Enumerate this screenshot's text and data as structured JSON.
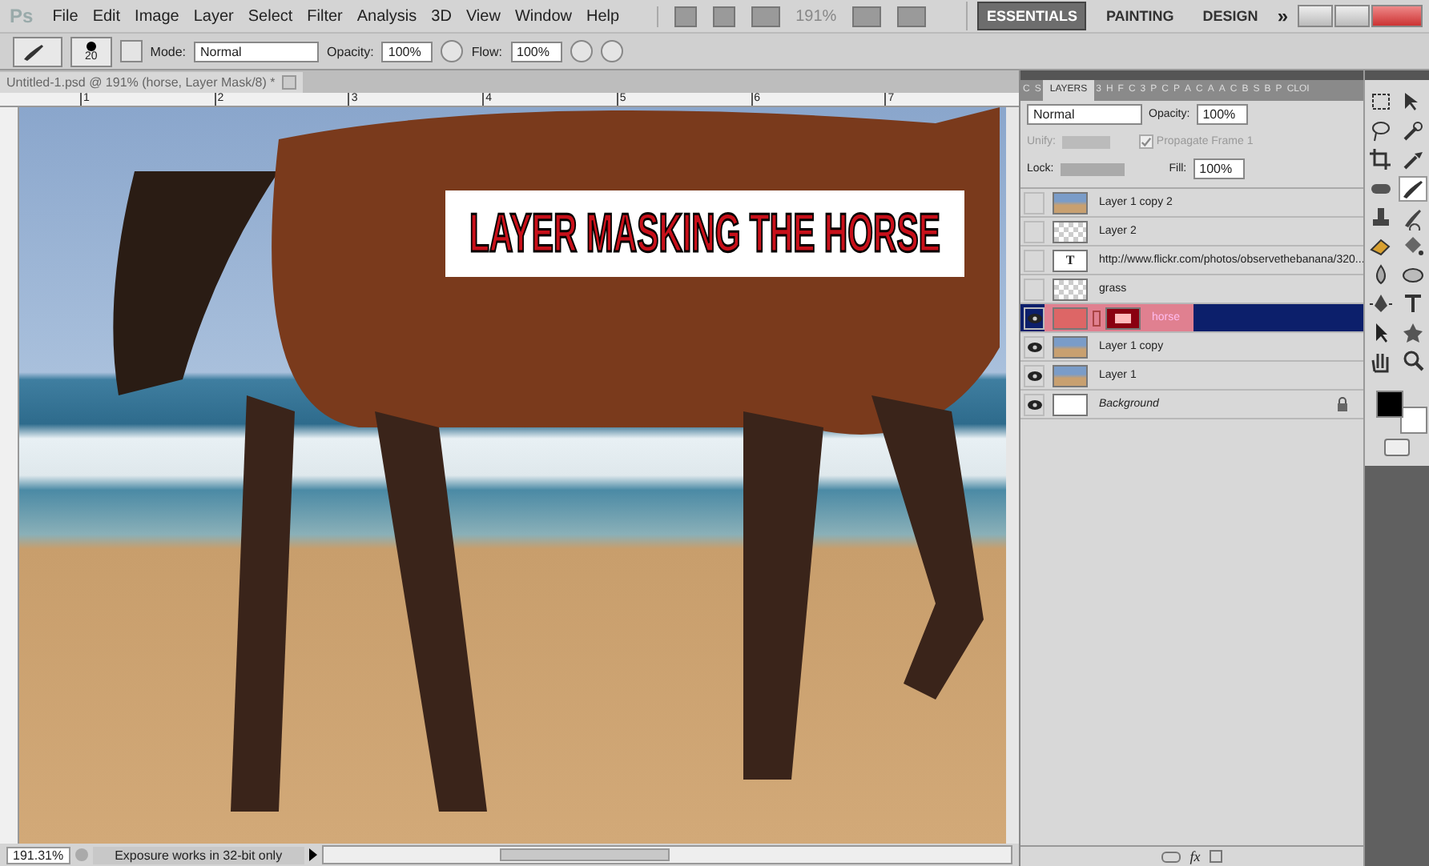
{
  "app_logo": "Ps",
  "menu": [
    "File",
    "Edit",
    "Image",
    "Layer",
    "Select",
    "Filter",
    "Analysis",
    "3D",
    "View",
    "Window",
    "Help"
  ],
  "zoom_menu": "191%",
  "workspaces": [
    {
      "label": "ESSENTIALS",
      "selected": true
    },
    {
      "label": "PAINTING",
      "selected": false
    },
    {
      "label": "DESIGN",
      "selected": false
    }
  ],
  "more_workspaces": "»",
  "options_bar": {
    "brush_size": "20",
    "mode_label": "Mode:",
    "mode": "Normal",
    "opacity_label": "Opacity:",
    "opacity": "100%",
    "flow_label": "Flow:",
    "flow": "100%"
  },
  "document_tab": {
    "title": "Untitled-1.psd @ 191% (horse, Layer Mask/8) *"
  },
  "ruler": [
    "1",
    "2",
    "3",
    "4",
    "5",
    "6",
    "7"
  ],
  "canvas_text": "LAYER MASKING THE HORSE",
  "layers_panel": {
    "tabs": [
      {
        "label": "C",
        "selected": false
      },
      {
        "label": "S",
        "selected": false
      },
      {
        "label": "LAYERS",
        "selected": true
      },
      {
        "label": "3",
        "selected": false
      },
      {
        "label": "H",
        "selected": false
      },
      {
        "label": "F",
        "selected": false
      },
      {
        "label": "C",
        "selected": false
      },
      {
        "label": "3",
        "selected": false
      },
      {
        "label": "P",
        "selected": false
      },
      {
        "label": "C",
        "selected": false
      },
      {
        "label": "P",
        "selected": false
      },
      {
        "label": "A",
        "selected": false
      },
      {
        "label": "C",
        "selected": false
      },
      {
        "label": "A",
        "selected": false
      },
      {
        "label": "A",
        "selected": false
      },
      {
        "label": "C",
        "selected": false
      },
      {
        "label": "B",
        "selected": false
      },
      {
        "label": "S",
        "selected": false
      },
      {
        "label": "B",
        "selected": false
      },
      {
        "label": "P",
        "selected": false
      },
      {
        "label": "CLOI",
        "selected": false
      }
    ],
    "blend_mode": "Normal",
    "opacity_label": "Opacity:",
    "opacity": "100%",
    "unify_label": "Unify:",
    "propagate": {
      "label": "Propagate Frame 1",
      "checked": true,
      "disabled": true
    },
    "lock_label": "Lock:",
    "fill_label": "Fill:",
    "fill": "100%",
    "layers": [
      {
        "name": "Layer 1 copy 2",
        "visible": false,
        "selected": false,
        "kind": "photo",
        "locked": false
      },
      {
        "name": "Layer 2",
        "visible": false,
        "selected": false,
        "kind": "transparent",
        "locked": false
      },
      {
        "name": "http://www.flickr.com/photos/observethebanana/320...",
        "visible": false,
        "selected": false,
        "kind": "text",
        "thumb_text": "T",
        "locked": false
      },
      {
        "name": "grass",
        "visible": false,
        "selected": false,
        "kind": "transparent",
        "locked": false
      },
      {
        "name": "horse",
        "visible": true,
        "selected": true,
        "kind": "masked",
        "locked": false
      },
      {
        "name": "Layer 1 copy",
        "visible": true,
        "selected": false,
        "kind": "photo",
        "locked": false
      },
      {
        "name": "Layer 1",
        "visible": true,
        "selected": false,
        "kind": "photo",
        "locked": false
      },
      {
        "name": "Background",
        "visible": true,
        "selected": false,
        "kind": "background",
        "locked": true
      }
    ],
    "fx_label": "fx"
  },
  "tools": [
    {
      "selected": false
    },
    {
      "selected": false
    },
    {
      "selected": false
    },
    {
      "selected": false
    },
    {
      "selected": false
    },
    {
      "selected": false
    },
    {
      "selected": false
    },
    {
      "selected": true
    },
    {
      "selected": false
    },
    {
      "selected": false
    },
    {
      "selected": false
    },
    {
      "selected": false
    },
    {
      "selected": false
    },
    {
      "selected": false
    },
    {
      "selected": false
    },
    {
      "selected": false
    },
    {
      "selected": false
    },
    {
      "selected": false
    },
    {
      "selected": false
    },
    {
      "selected": false
    }
  ],
  "status_bar": {
    "zoom": "191.31%",
    "message": "Exposure works in 32-bit only"
  }
}
